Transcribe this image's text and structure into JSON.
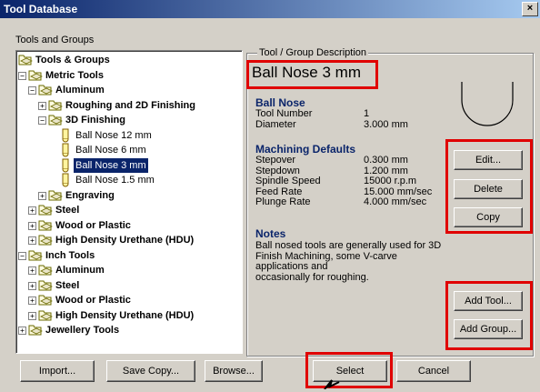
{
  "window": {
    "title": "Tool Database",
    "close_glyph": "×"
  },
  "left_group": {
    "label": "Tools and Groups"
  },
  "tree": [
    {
      "label": "Tools & Groups",
      "bold": true,
      "expander": "",
      "icon": "folder",
      "indent": 0
    },
    {
      "label": "Metric Tools",
      "bold": true,
      "expander": "−",
      "icon": "folder",
      "indent": 1
    },
    {
      "label": "Aluminum",
      "bold": true,
      "expander": "−",
      "icon": "folder",
      "indent": 2
    },
    {
      "label": "Roughing and 2D Finishing",
      "bold": true,
      "expander": "+",
      "icon": "folder",
      "indent": 3
    },
    {
      "label": "3D Finishing",
      "bold": true,
      "expander": "−",
      "icon": "folder",
      "indent": 3
    },
    {
      "label": "Ball Nose 12 mm",
      "bold": false,
      "expander": "",
      "icon": "tool",
      "indent": 4
    },
    {
      "label": "Ball Nose 6 mm",
      "bold": false,
      "expander": "",
      "icon": "tool",
      "indent": 4
    },
    {
      "label": "Ball Nose 3 mm",
      "bold": false,
      "expander": "",
      "icon": "tool",
      "indent": 4,
      "selected": true
    },
    {
      "label": "Ball Nose 1.5 mm",
      "bold": false,
      "expander": "",
      "icon": "tool",
      "indent": 4
    },
    {
      "label": "Engraving",
      "bold": true,
      "expander": "+",
      "icon": "folder",
      "indent": 3
    },
    {
      "label": "Steel",
      "bold": true,
      "expander": "+",
      "icon": "folder",
      "indent": 2
    },
    {
      "label": "Wood or Plastic",
      "bold": true,
      "expander": "+",
      "icon": "folder",
      "indent": 2
    },
    {
      "label": "High Density Urethane (HDU)",
      "bold": true,
      "expander": "+",
      "icon": "folder",
      "indent": 2
    },
    {
      "label": "Inch Tools",
      "bold": true,
      "expander": "−",
      "icon": "folder",
      "indent": 1
    },
    {
      "label": "Aluminum",
      "bold": true,
      "expander": "+",
      "icon": "folder",
      "indent": 2
    },
    {
      "label": "Steel",
      "bold": true,
      "expander": "+",
      "icon": "folder",
      "indent": 2
    },
    {
      "label": "Wood or Plastic",
      "bold": true,
      "expander": "+",
      "icon": "folder",
      "indent": 2
    },
    {
      "label": "High Density Urethane (HDU)",
      "bold": true,
      "expander": "+",
      "icon": "folder",
      "indent": 2
    },
    {
      "label": "Jewellery Tools",
      "bold": true,
      "expander": "+",
      "icon": "folder",
      "indent": 1
    }
  ],
  "description": {
    "group_label": "Tool / Group Description",
    "name": "Ball Nose 3 mm",
    "section1": {
      "title": "Ball Nose",
      "rows": [
        {
          "label": "Tool Number",
          "value": "1"
        },
        {
          "label": "Diameter",
          "value": "3.000 mm"
        }
      ]
    },
    "section2": {
      "title": "Machining Defaults",
      "rows": [
        {
          "label": "Stepover",
          "value": "0.300 mm"
        },
        {
          "label": "Stepdown",
          "value": "1.200 mm"
        },
        {
          "label": "Spindle Speed",
          "value": "15000 r.p.m"
        },
        {
          "label": "Feed Rate",
          "value": "15.000 mm/sec"
        },
        {
          "label": "Plunge Rate",
          "value": "4.000 mm/sec"
        }
      ]
    },
    "notes": {
      "title": "Notes",
      "lines": [
        "Ball nosed tools are generally used for 3D",
        "Finish Machining, some V-carve",
        "applications and",
        "occasionally for roughing."
      ]
    }
  },
  "buttons": {
    "edit": "Edit...",
    "delete": "Delete",
    "copy": "Copy",
    "add_tool": "Add Tool...",
    "add_group": "Add Group...",
    "import": "Import...",
    "save_copy": "Save Copy...",
    "browse": "Browse...",
    "select": "Select",
    "cancel": "Cancel"
  },
  "colors": {
    "highlight": "#e00000",
    "selection": "#0a246a",
    "heading": "#0a246a"
  }
}
